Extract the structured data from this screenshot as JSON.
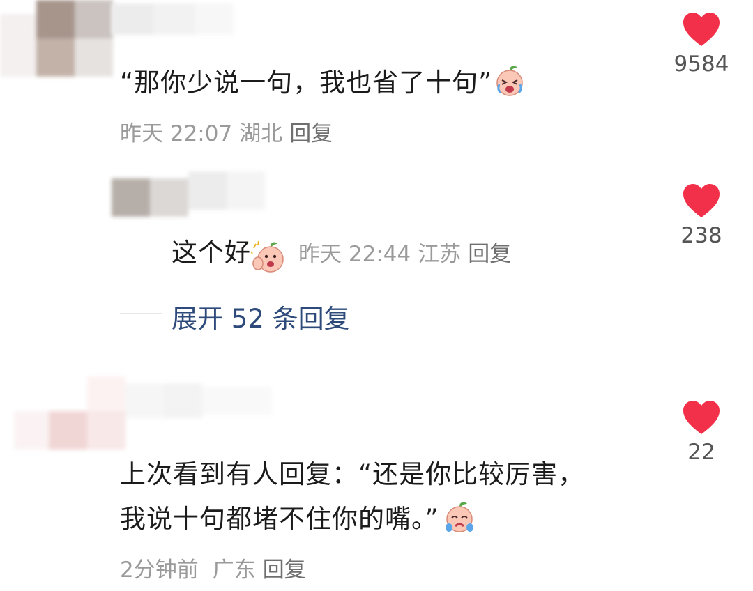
{
  "comments": [
    {
      "text": "“那你少说一句，我也省了十句”",
      "time": "昨天 22:07",
      "location": "湖北",
      "reply_label": "回复",
      "likes": "9584",
      "emoji": "crying-laugh-peach-icon"
    },
    {
      "text": "这个好",
      "time": "昨天 22:44",
      "location": "江苏",
      "reply_label": "回复",
      "likes": "238",
      "emoji": "clapping-peach-icon"
    },
    {
      "text_line1": "上次看到有人回复：“还是你比较厉害，",
      "text_line2": "我说十句都堵不住你的嘴。”",
      "time": "2分钟前",
      "location": "广东",
      "reply_label": "回复",
      "likes": "22",
      "emoji": "sobbing-peach-icon"
    }
  ],
  "expand_replies": "展开 52 条回复",
  "colors": {
    "like": "#f2304a",
    "link": "#2d4a7a",
    "meta": "#9a9a9a"
  }
}
